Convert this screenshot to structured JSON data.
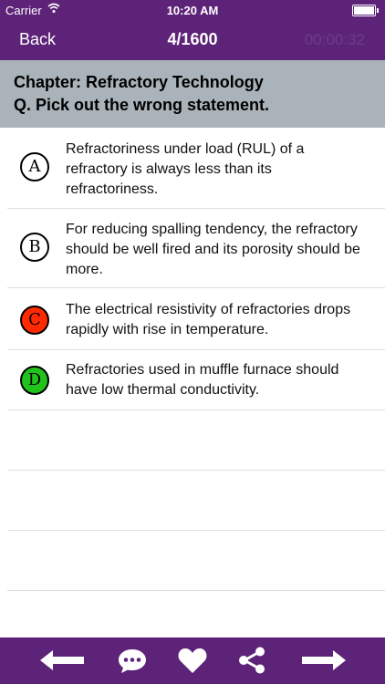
{
  "status": {
    "carrier": "Carrier",
    "time": "10:20 AM"
  },
  "nav": {
    "back_label": "Back",
    "counter": "4/1600",
    "timer": "00:00:32"
  },
  "question": {
    "chapter": "Chapter: Refractory Technology",
    "prompt": "Q. Pick out the wrong statement."
  },
  "options": [
    {
      "letter": "A",
      "text": "Refractoriness under load (RUL) of a refractory is always less than its refractoriness.",
      "color": "#ffffff"
    },
    {
      "letter": "B",
      "text": "For reducing spalling tendency, the refractory should be well fired and its porosity should be more.",
      "color": "#ffffff"
    },
    {
      "letter": "C",
      "text": "The electrical resistivity of refractories drops rapidly with rise in temperature.",
      "color": "#ff2a00"
    },
    {
      "letter": "D",
      "text": "Refractories used in muffle furnace should have low thermal conductivity.",
      "color": "#22c21c"
    }
  ],
  "toolbar_icons": [
    "arrow-left-icon",
    "comment-icon",
    "heart-icon",
    "share-icon",
    "arrow-right-icon"
  ]
}
